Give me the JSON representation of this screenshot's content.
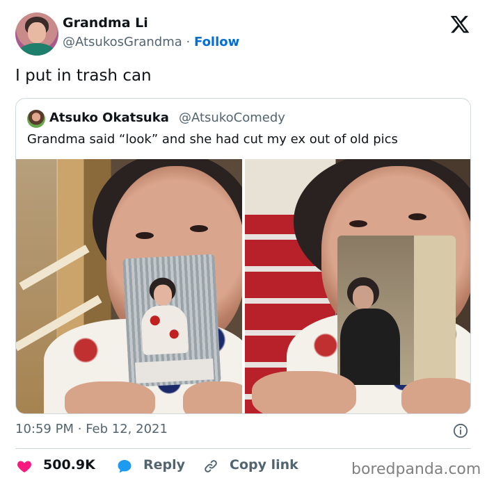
{
  "author": {
    "name": "Grandma Li",
    "handle": "@AtsukosGrandma",
    "separator": "·",
    "follow_label": "Follow",
    "avatar_icon": "avatar-photo"
  },
  "platform_icon": "x-logo-icon",
  "tweet": {
    "text": "I put in trash can"
  },
  "quoted": {
    "name": "Atsuko Okatsuka",
    "handle": "@AtsukoComedy",
    "text": "Grandma said “look” and she had cut my ex out of old pics",
    "photos": [
      "photo-left",
      "photo-right"
    ]
  },
  "meta": {
    "time": "10:59 PM",
    "separator": "·",
    "date": "Feb 12, 2021",
    "info_icon": "info-icon"
  },
  "actions": {
    "likes": "500.9K",
    "reply_label": "Reply",
    "copy_link_label": "Copy link"
  },
  "watermark": "boredpanda.com",
  "colors": {
    "accent": "#006fd6",
    "like": "#f91880",
    "reply": "#1d9bf0",
    "text": "#0f1419",
    "muted": "#536471",
    "border": "#cfd9de"
  }
}
